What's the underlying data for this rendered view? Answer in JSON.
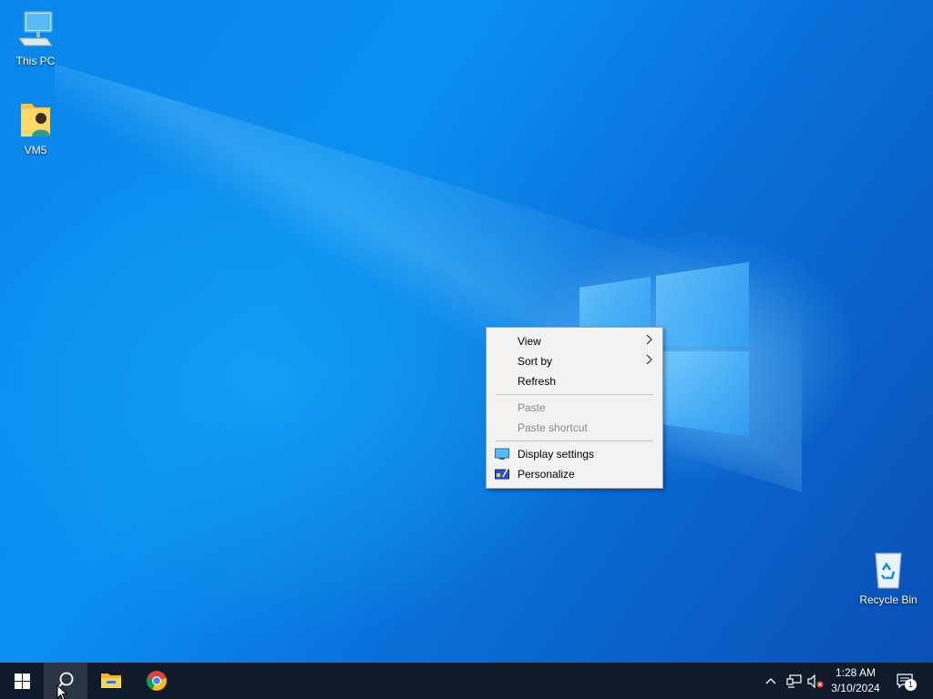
{
  "desktop": {
    "icons": [
      {
        "label": "This PC",
        "icon": "this-pc-icon"
      },
      {
        "label": "VM5",
        "icon": "user-folder-icon"
      },
      {
        "label": "Recycle Bin",
        "icon": "recycle-bin-icon"
      }
    ]
  },
  "context_menu": {
    "items": [
      {
        "label": "View",
        "has_submenu": true,
        "enabled": true
      },
      {
        "label": "Sort by",
        "has_submenu": true,
        "enabled": true
      },
      {
        "label": "Refresh",
        "has_submenu": false,
        "enabled": true
      },
      {
        "label": "Paste",
        "has_submenu": false,
        "enabled": false
      },
      {
        "label": "Paste shortcut",
        "has_submenu": false,
        "enabled": false
      },
      {
        "label": "Display settings",
        "has_submenu": false,
        "enabled": true,
        "icon": "display-icon"
      },
      {
        "label": "Personalize",
        "has_submenu": false,
        "enabled": true,
        "icon": "personalize-icon"
      }
    ]
  },
  "taskbar": {
    "buttons": [
      {
        "name": "start",
        "icon": "windows-logo-icon"
      },
      {
        "name": "search",
        "icon": "search-icon",
        "active": true
      },
      {
        "name": "file-explorer",
        "icon": "folder-icon"
      },
      {
        "name": "chrome",
        "icon": "chrome-icon"
      }
    ],
    "tray": {
      "icons": [
        "chevron-up-icon",
        "network-icon",
        "volume-muted-icon"
      ],
      "time": "1:28 AM",
      "date": "3/10/2024",
      "notification_count": "1"
    }
  },
  "colors": {
    "taskbar_bg": "#0f1a2a",
    "menu_bg": "#f2f2f2",
    "wallpaper_blue": "#0a86ea"
  }
}
